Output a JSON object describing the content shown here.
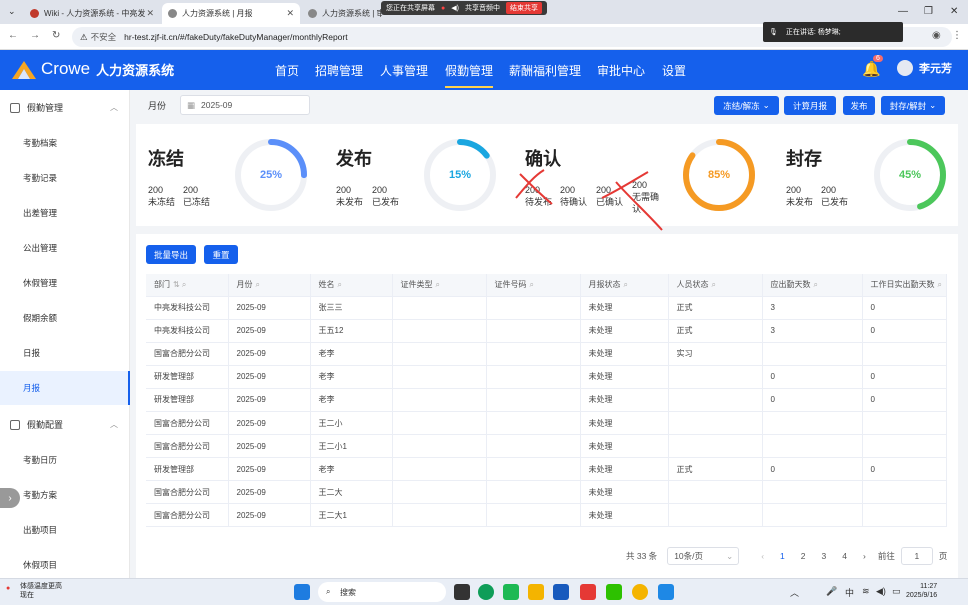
{
  "browser": {
    "tabs": [
      {
        "title": "Wiki - 人力资源系统 - 中亮发"
      },
      {
        "title": "人力资源系统 | 月报"
      },
      {
        "title": "人力资源系统 | 审批"
      }
    ],
    "insecure_label": "不安全",
    "url": "hr-test.zjf-it.cn/#/fakeDuty/fakeDutyManager/monthlyReport",
    "share_banner": {
      "sharing": "您正在共享屏幕",
      "audio": "共享音频中",
      "stop": "结束共享"
    },
    "speaking": "正在讲话: 杨梦琳;"
  },
  "app": {
    "brand": "Crowe",
    "system_name": "人力资源系统",
    "menu": [
      "首页",
      "招聘管理",
      "人事管理",
      "假勤管理",
      "薪酬福利管理",
      "审批中心",
      "设置"
    ],
    "active_menu": "假勤管理",
    "notification_count": "6",
    "user_name": "李元芳"
  },
  "sidebar": {
    "group1": "假勤管理",
    "items1": [
      "考勤档案",
      "考勤记录",
      "出差管理",
      "公出管理",
      "休假管理",
      "假期余额",
      "日报",
      "月报"
    ],
    "group2": "假勤配置",
    "items2": [
      "考勤日历",
      "考勤方案",
      "出勤项目",
      "休假项目"
    ],
    "active_item": "月报"
  },
  "toolbar": {
    "month_label": "月份",
    "month_value": "2025-09",
    "btn_freeze": "冻结/解冻",
    "btn_calc": "计算月报",
    "btn_publish": "发布",
    "btn_seal": "封存/解封"
  },
  "stats": {
    "freeze": {
      "title": "冻结",
      "n1": "200",
      "l1": "未冻结",
      "n2": "200",
      "l2": "已冻结",
      "percent": "25%",
      "fraction": 0.25,
      "color": "#5b8ff9"
    },
    "publish": {
      "title": "发布",
      "n1": "200",
      "l1": "未发布",
      "n2": "200",
      "l2": "已发布",
      "percent": "15%",
      "fraction": 0.15,
      "color": "#1aa6e0"
    },
    "confirm": {
      "title": "确认",
      "n1": "200",
      "l1": "待发布",
      "n2": "200",
      "l2": "待确认",
      "n3": "200",
      "l3": "已确认",
      "n4": "200",
      "l4": "无需确认",
      "percent": "85%",
      "fraction": 0.85,
      "color": "#f59a23"
    },
    "seal": {
      "title": "封存",
      "n1": "200",
      "l1": "未发布",
      "n2": "200",
      "l2": "已发布",
      "percent": "45%",
      "fraction": 0.45,
      "color": "#4cc75b"
    }
  },
  "actions": {
    "export": "批量导出",
    "reset": "重置"
  },
  "table": {
    "columns": [
      "部门",
      "月份",
      "姓名",
      "证件类型",
      "证件号码",
      "月报状态",
      "人员状态",
      "应出勤天数",
      "工作日实出勤天数"
    ],
    "rows": [
      [
        "中亮发科技公司",
        "2025-09",
        "张三三",
        "",
        "",
        "未处理",
        "正式",
        "3",
        "0"
      ],
      [
        "中亮发科技公司",
        "2025-09",
        "王五12",
        "",
        "",
        "未处理",
        "正式",
        "3",
        "0"
      ],
      [
        "国富合肥分公司",
        "2025-09",
        "老李",
        "",
        "",
        "未处理",
        "实习",
        "",
        ""
      ],
      [
        "研发管理部",
        "2025-09",
        "老李",
        "",
        "",
        "未处理",
        "",
        "0",
        "0"
      ],
      [
        "研发管理部",
        "2025-09",
        "老李",
        "",
        "",
        "未处理",
        "",
        "0",
        "0"
      ],
      [
        "国富合肥分公司",
        "2025-09",
        "王二小",
        "",
        "",
        "未处理",
        "",
        "",
        ""
      ],
      [
        "国富合肥分公司",
        "2025-09",
        "王二小1",
        "",
        "",
        "未处理",
        "",
        "",
        ""
      ],
      [
        "研发管理部",
        "2025-09",
        "老李",
        "",
        "",
        "未处理",
        "正式",
        "0",
        "0"
      ],
      [
        "国富合肥分公司",
        "2025-09",
        "王二大",
        "",
        "",
        "未处理",
        "",
        "",
        ""
      ],
      [
        "国富合肥分公司",
        "2025-09",
        "王二大1",
        "",
        "",
        "未处理",
        "",
        "",
        ""
      ]
    ]
  },
  "pagination": {
    "total": "共 33 条",
    "page_size": "10条/页",
    "pages": [
      "1",
      "2",
      "3",
      "4"
    ],
    "current": "1",
    "goto_label": "前往",
    "goto_value": "1",
    "page_suffix": "页"
  },
  "taskbar": {
    "weather_line1": "体感温度更高",
    "weather_line2": "现在",
    "weather_badge": "4",
    "search": "搜索",
    "ime": "中",
    "time": "11:27",
    "date": "2025/9/16"
  }
}
